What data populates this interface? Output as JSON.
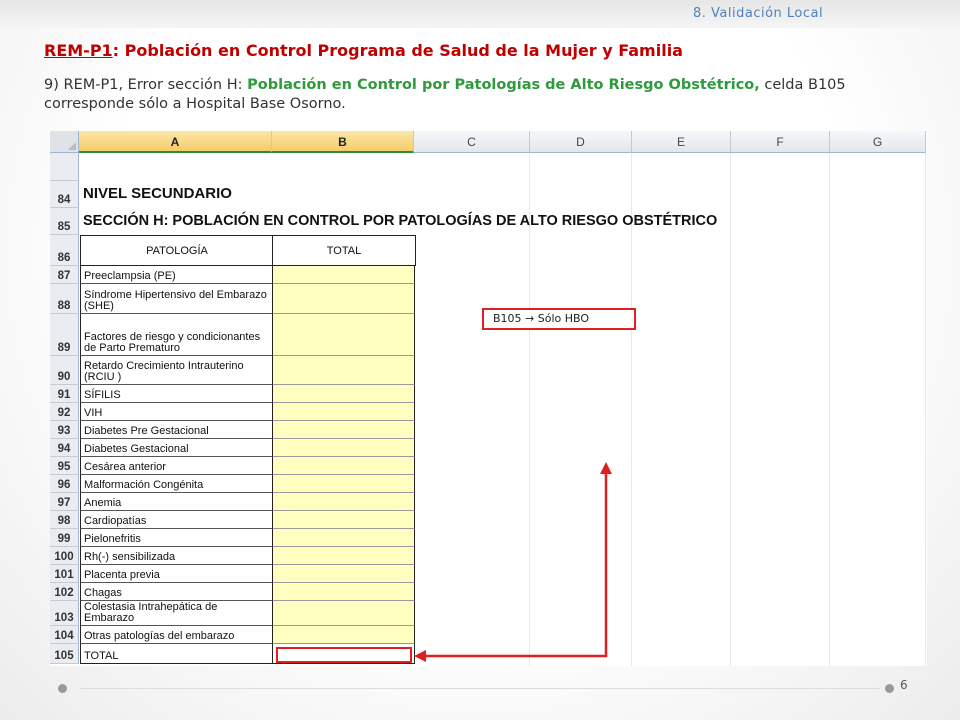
{
  "header": {
    "section_label": "8. Validación Local"
  },
  "title": {
    "code": "REM-P1",
    "text": ": Población en Control  Programa de Salud de la Mujer y Familia"
  },
  "description": {
    "prefix": "9) REM-P1, Error sección H: ",
    "highlight": "Población en Control por Patologías de Alto Riesgo Obstétrico,",
    "suffix": " celda B105 corresponde sólo a Hospital Base Osorno."
  },
  "sheet": {
    "columns": [
      "A",
      "B",
      "C",
      "D",
      "E",
      "F",
      "G"
    ],
    "selected_columns": [
      "A",
      "B"
    ],
    "heading_84": {
      "row": "84",
      "text": "NIVEL SECUNDARIO"
    },
    "heading_85": {
      "row": "85",
      "text": "SECCIÓN H: POBLACIÓN EN CONTROL POR PATOLOGÍAS DE ALTO RIESGO OBSTÉTRICO"
    },
    "table_header": {
      "row": "86",
      "col_a": "PATOLOGÍA",
      "col_b": "TOTAL"
    },
    "rows": [
      {
        "row": "87",
        "label": "Preeclampsia (PE)"
      },
      {
        "row": "88",
        "label": "Síndrome Hipertensivo del Embarazo (SHE)"
      },
      {
        "row": "89",
        "label": "Factores de riesgo y condicionantes de Parto Prematuro"
      },
      {
        "row": "90",
        "label": "Retardo Crecimiento Intrauterino (RCIU )"
      },
      {
        "row": "91",
        "label": "SÍFILIS"
      },
      {
        "row": "92",
        "label": "VIH"
      },
      {
        "row": "93",
        "label": "Diabetes Pre Gestacional"
      },
      {
        "row": "94",
        "label": "Diabetes Gestacional"
      },
      {
        "row": "95",
        "label": "Cesárea anterior"
      },
      {
        "row": "96",
        "label": "Malformación Congénita"
      },
      {
        "row": "97",
        "label": "Anemia"
      },
      {
        "row": "98",
        "label": "Cardiopatías"
      },
      {
        "row": "99",
        "label": "Pielonefritis"
      },
      {
        "row": "100",
        "label": "Rh(-) sensibilizada"
      },
      {
        "row": "101",
        "label": "Placenta previa"
      },
      {
        "row": "102",
        "label": "Chagas"
      },
      {
        "row": "103",
        "label": "Colestasia Intrahepática de Embarazo"
      },
      {
        "row": "104",
        "label": "Otras patologías del embarazo"
      },
      {
        "row": "105",
        "label": "TOTAL"
      }
    ]
  },
  "callout": {
    "cell": "B105",
    "arrow": "→",
    "text": "Sólo HBO"
  },
  "footer": {
    "page_number": "6"
  },
  "colors": {
    "accent_red": "#e02020",
    "title_red": "#c00000",
    "highlight_green": "#2e9a3c",
    "input_yellow": "#ffffc0",
    "header_blue": "#4f81bd"
  }
}
